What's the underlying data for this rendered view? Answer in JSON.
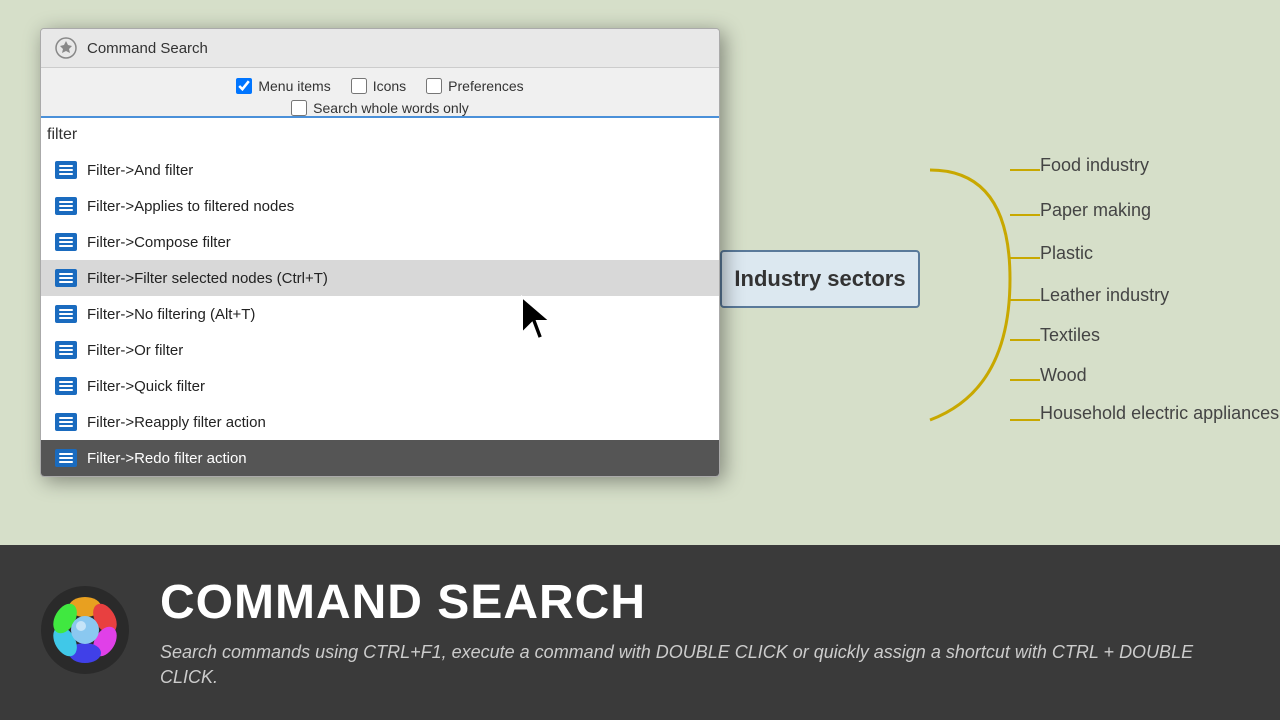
{
  "background": {
    "color": "#d6dfc9"
  },
  "dialog": {
    "title": "Command Search",
    "options": {
      "menu_items_label": "Menu items",
      "icons_label": "Icons",
      "preferences_label": "Preferences",
      "whole_words_label": "Search whole words only",
      "menu_items_checked": true,
      "icons_checked": false,
      "preferences_checked": false,
      "whole_words_checked": false
    },
    "search_input": {
      "value": "filter",
      "placeholder": ""
    },
    "results": [
      {
        "id": 1,
        "label": "Filter->And filter",
        "selected": false,
        "dark": false
      },
      {
        "id": 2,
        "label": "Filter->Applies to filtered nodes",
        "selected": false,
        "dark": false
      },
      {
        "id": 3,
        "label": "Filter->Compose filter",
        "selected": false,
        "dark": false
      },
      {
        "id": 4,
        "label": "Filter->Filter selected nodes (Ctrl+T)",
        "selected": true,
        "dark": false
      },
      {
        "id": 5,
        "label": "Filter->No filtering (Alt+T)",
        "selected": false,
        "dark": false
      },
      {
        "id": 6,
        "label": "Filter->Or filter",
        "selected": false,
        "dark": false
      },
      {
        "id": 7,
        "label": "Filter->Quick filter",
        "selected": false,
        "dark": false
      },
      {
        "id": 8,
        "label": "Filter->Reapply filter action",
        "selected": false,
        "dark": false
      },
      {
        "id": 9,
        "label": "Filter->Redo filter action",
        "selected": false,
        "dark": true
      }
    ]
  },
  "mindmap": {
    "center_label": "Industry sectors",
    "branches": [
      {
        "id": 1,
        "label": "Food industry"
      },
      {
        "id": 2,
        "label": "Paper making"
      },
      {
        "id": 3,
        "label": "Plastic"
      },
      {
        "id": 4,
        "label": "Leather industry"
      },
      {
        "id": 5,
        "label": "Textiles"
      },
      {
        "id": 6,
        "label": "Wood"
      },
      {
        "id": 7,
        "label": "Household electric appliances"
      }
    ]
  },
  "bottom_bar": {
    "title": "COMMAND SEARCH",
    "description": "Search commands using CTRL+F1, execute a command with DOUBLE CLICK or quickly assign a shortcut with CTRL + DOUBLE CLICK."
  }
}
